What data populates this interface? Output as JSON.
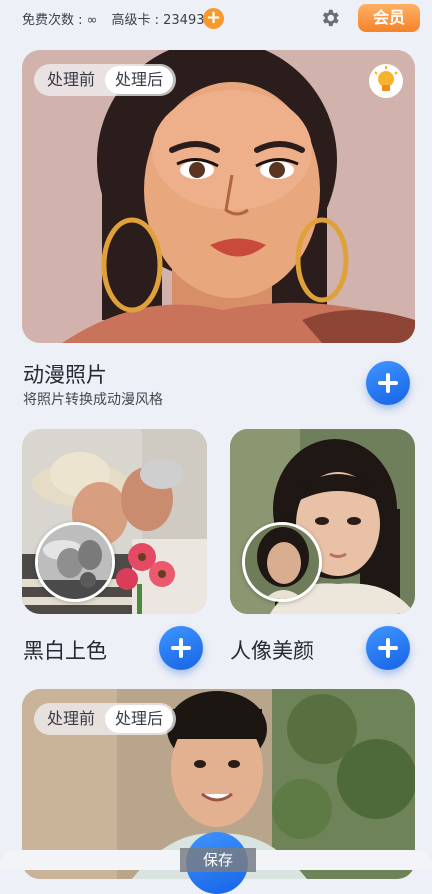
{
  "header": {
    "free_label": "免费次数 : ∞",
    "premium_label": "高级卡 : 23493",
    "add_icon": "plus-circle-icon",
    "settings_icon": "gear-icon",
    "vip_label": "会员"
  },
  "colors": {
    "accent_blue": "#2a7cf6",
    "vip_orange": "#f5832a",
    "background": "#eef0f7"
  },
  "anime_card": {
    "toggle_before": "处理前",
    "toggle_after": "处理后",
    "tip_icon": "lightbulb-icon",
    "title": "动漫照片",
    "subtitle": "将照片转换成动漫风格"
  },
  "colorize_card": {
    "title": "黑白上色"
  },
  "beauty_card": {
    "title": "人像美颜"
  },
  "bottom_card": {
    "toggle_before": "处理前",
    "toggle_after": "处理后"
  },
  "footer": {
    "save_label": "保存"
  }
}
